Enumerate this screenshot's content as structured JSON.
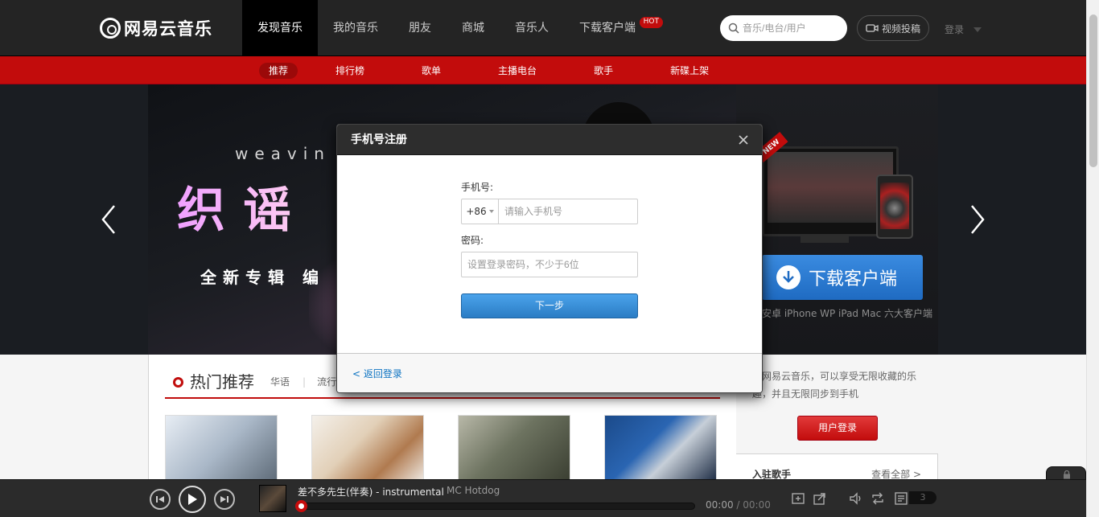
{
  "header": {
    "logo_text": "网易云音乐",
    "nav": [
      {
        "label": "发现音乐",
        "active": true
      },
      {
        "label": "我的音乐",
        "active": false
      },
      {
        "label": "朋友",
        "active": false
      },
      {
        "label": "商城",
        "active": false
      },
      {
        "label": "音乐人",
        "active": false
      },
      {
        "label": "下载客户端",
        "active": false
      }
    ],
    "hot_badge": "HOT",
    "search_placeholder": "音乐/电台/用户",
    "video_upload": "视频投稿",
    "login": "登录"
  },
  "subnav": [
    "推荐",
    "排行榜",
    "歌单",
    "主播电台",
    "歌手",
    "新碟上架"
  ],
  "banner": {
    "en_text": "weavin",
    "title": "织谣",
    "subtitle": "全新专辑  编",
    "new_tag": "NEW",
    "download_button": "下载客户端",
    "download_sub": "安卓 iPhone WP iPad Mac 六大客户端"
  },
  "hot": {
    "title": "热门推荐",
    "tabs": [
      "华语",
      "流行"
    ]
  },
  "sidebar": {
    "login_text": "录网易云音乐，可以享受无限收藏的乐趣，并且无限同步到手机",
    "login_button": "用户登录",
    "singers_title": "入驻歌手",
    "view_all": "查看全部 >"
  },
  "player": {
    "song": "差不多先生(伴奏) - instrumental",
    "artist": "MC Hotdog",
    "current_time": "00:00",
    "total_time": "00:00",
    "playlist_count": "3",
    "progress": 0
  },
  "modal": {
    "title": "手机号注册",
    "phone_label": "手机号:",
    "country_code": "+86",
    "phone_placeholder": "请输入手机号",
    "password_label": "密码:",
    "password_placeholder": "设置登录密码，不少于6位",
    "next_button": "下一步",
    "back_link": "< 返回登录"
  },
  "colors": {
    "brand_red": "#c20c0c",
    "topbar": "#242424",
    "button_blue": "#2a7cc4"
  }
}
